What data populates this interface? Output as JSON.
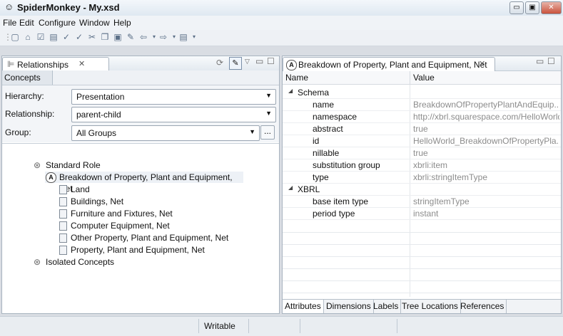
{
  "window": {
    "title": "SpiderMonkey - My.xsd"
  },
  "menu": [
    "File",
    "Edit",
    "Configure",
    "Window",
    "Help"
  ],
  "left_panel": {
    "tab_label": "Relationships",
    "subtab_label": "Concepts",
    "hierarchy_label": "Hierarchy:",
    "hierarchy_value": "Presentation",
    "relationship_label": "Relationship:",
    "relationship_value": "parent-child",
    "group_label": "Group:",
    "group_value": "All Groups",
    "group_more": "...",
    "tree": {
      "standard_role": "Standard Role",
      "root": "Breakdown of Property, Plant and Equipment, Net",
      "children": [
        "Land",
        "Buildings, Net",
        "Furniture and Fixtures, Net",
        "Computer Equipment, Net",
        "Other Property, Plant and Equipment, Net",
        "Property, Plant and Equipment, Net"
      ],
      "isolated": "Isolated Concepts"
    }
  },
  "right_panel": {
    "tab_label": "Breakdown of Property, Plant and Equipment, Net",
    "columns": {
      "name": "Name",
      "value": "Value"
    },
    "schema_group": "Schema",
    "schema_rows": [
      {
        "name": "name",
        "value": "BreakdownOfPropertyPlantAndEquip..."
      },
      {
        "name": "namespace",
        "value": "http://xbrl.squarespace.com/HelloWorld"
      },
      {
        "name": "abstract",
        "value": "true"
      },
      {
        "name": "id",
        "value": "HelloWorld_BreakdownOfPropertyPla..."
      },
      {
        "name": "nillable",
        "value": "true"
      },
      {
        "name": "substitution group",
        "value": "xbrli:item"
      },
      {
        "name": "type",
        "value": "xbrli:stringItemType"
      }
    ],
    "xbrl_group": "XBRL",
    "xbrl_rows": [
      {
        "name": "base item type",
        "value": "stringItemType"
      },
      {
        "name": "period type",
        "value": "instant"
      }
    ],
    "bottom_tabs": [
      "Attributes",
      "Dimensions",
      "Labels",
      "Tree Locations",
      "References"
    ]
  },
  "status": {
    "writable": "Writable"
  },
  "icons": {
    "app": "spider-monkey-icon",
    "close_tab": "close-icon",
    "expand": "expand-triangle-icon"
  }
}
